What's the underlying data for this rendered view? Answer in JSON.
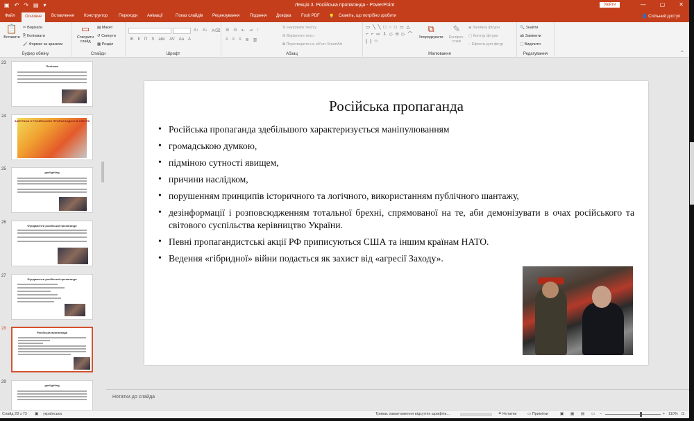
{
  "window": {
    "title": "Лекція 3. Російська пропаганда  -  PowerPoint",
    "sign_in": "Увійти",
    "qat": [
      "▣",
      "↶",
      "↷",
      "▤",
      "▾"
    ],
    "controls": [
      "—",
      "▢",
      "✕"
    ]
  },
  "tabs": [
    {
      "label": "Файл"
    },
    {
      "label": "Основне",
      "active": true
    },
    {
      "label": "Вставлення"
    },
    {
      "label": "Конструктор"
    },
    {
      "label": "Переходи"
    },
    {
      "label": "Анімації"
    },
    {
      "label": "Показ слайдів"
    },
    {
      "label": "Рецензування"
    },
    {
      "label": "Подання"
    },
    {
      "label": "Довідка"
    },
    {
      "label": "Foxit PDF"
    },
    {
      "label": "Скажіть, що потрібно зробити"
    }
  ],
  "share_label": "Спільний доступ",
  "ribbon": {
    "clipboard": {
      "label": "Буфер обміну",
      "paste": "Вставити",
      "cut": "Вирізати",
      "copy": "Копіювати",
      "format_painter": "Формат за зразком"
    },
    "slides": {
      "label": "Слайди",
      "new_slide": "Створити слайд",
      "layout": "Макет",
      "reset": "Скинути",
      "section": "Розділ"
    },
    "font": {
      "label": "Шрифт",
      "format_glyphs": [
        "Ж",
        "К",
        "П",
        "S",
        "abc",
        "AV",
        "Aa",
        "A"
      ]
    },
    "paragraph": {
      "label": "Абзац",
      "text_direction": "Напрямок тексту",
      "align_text": "Вирівняти текст",
      "smartart": "Перетворити на об'єкт SmartArt"
    },
    "drawing": {
      "label": "Малювання",
      "arrange": "Упорядкувати",
      "quick_styles": "Експрес-стилі",
      "shape_fill": "Заливка фігури",
      "shape_outline": "Контур фігури",
      "shape_effects": "Ефекти для фігур",
      "shapes": "▭ ╲ ╲ □ ○ □ ▭ △ ⌐ ⌐ ⇨ ⇩ ◇ ⊖ ▷ ⌒ { } ☆"
    },
    "editing": {
      "label": "Редагування",
      "find": "Знайти",
      "replace": "Замінити",
      "select": "Виділити"
    }
  },
  "thumbnails": [
    {
      "num": "23",
      "title": "Політика"
    },
    {
      "num": "24",
      "title": "ЗАПУТАНА З РОСІЙСЬКОЮ ПРОПАГАНДОЮ В ЄВРОПІ"
    },
    {
      "num": "25",
      "title": "gaslighting"
    },
    {
      "num": "26",
      "title": "Фундаменти російської пропаганди"
    },
    {
      "num": "27",
      "title": "Фундаменти російської пропаганди"
    },
    {
      "num": "28",
      "title": "Російська пропаганда",
      "selected": true
    },
    {
      "num": "29",
      "title": "gaslighting"
    }
  ],
  "slide": {
    "title": "Російська пропаганда",
    "bullets": [
      "Російська пропаганда здебільшого характеризується маніпулюванням",
      "громадською думкою,",
      "підміною сутності явищем,",
      "причини наслідком,",
      "порушенням принципів історичного та логічного, використанням публічного шантажу,",
      "дезінформації і розповсюдженням тотальної брехні, спрямованої на те, аби демонізувати в очах російського та світового суспільства керівництво України.",
      "Певні пропагандистські акції РФ приписуються США та іншим країнам НАТО.",
      "Ведення «гібридної» війни подається як захист від «агресії Заходу»."
    ]
  },
  "notes_placeholder": "Нотатки до слайда",
  "status": {
    "slide_counter": "Слайд 28 з 73",
    "language": "українська",
    "font_warning": "Триває завантаження відсутніх шрифтів...",
    "notes": "Нотатки",
    "comments": "Примітки",
    "zoom": "110%"
  },
  "colors": {
    "accent": "#c43e1c",
    "selection": "#d35230"
  }
}
